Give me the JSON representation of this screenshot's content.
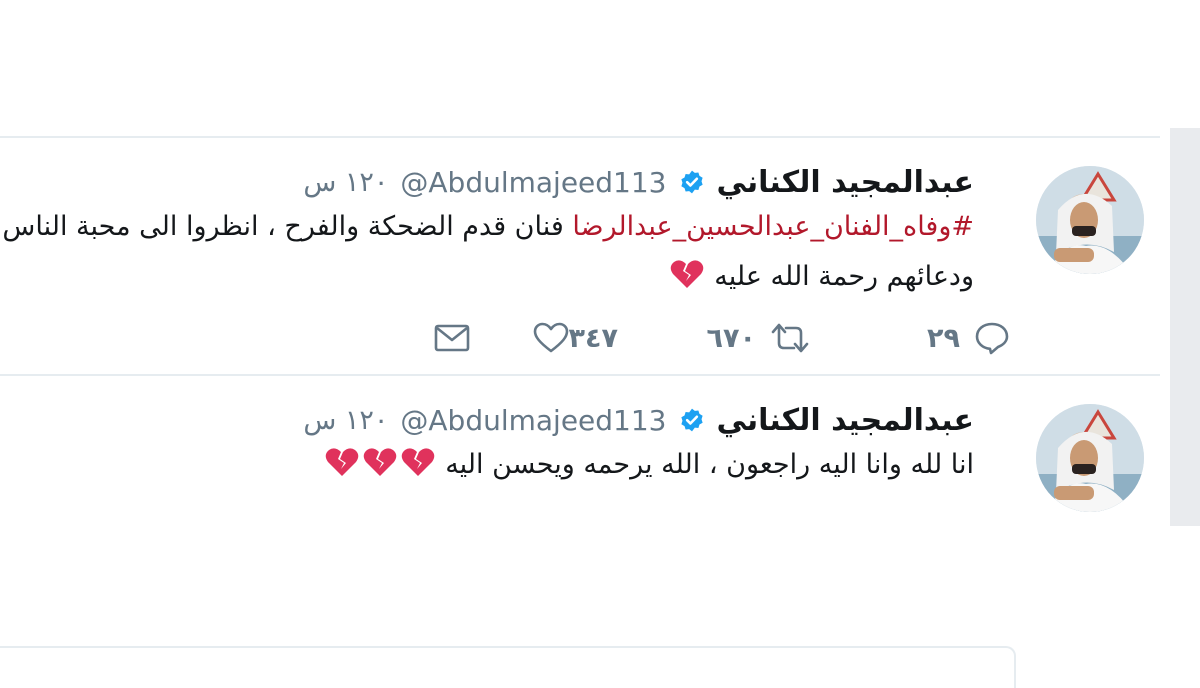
{
  "colors": {
    "hashtag": "#b2182b",
    "secondary_text": "#657786",
    "verified_badge": "#1da1f2",
    "broken_heart": "#e0325c"
  },
  "tweets": [
    {
      "display_name": "عبدالمجيد الكناني",
      "handle": "@Abdulmajeed113",
      "timestamp": "١٢٠ س",
      "hashtag": "#وفاه_الفنان_عبدالحسين_عبدالرضا",
      "text": " فنان قدم الضحكة والفرح ، انظروا الى محبة الناس ودعائهم رحمة الله عليه",
      "emoji": [
        "broken-heart"
      ],
      "replies": "٢٩",
      "retweets": "٦٧٠",
      "likes": "٣٤٧"
    },
    {
      "display_name": "عبدالمجيد الكناني",
      "handle": "@Abdulmajeed113",
      "timestamp": "١٢٠ س",
      "text": "انا لله وانا اليه راجعون ، الله يرحمه ويحسن اليه",
      "emoji": [
        "broken-heart",
        "broken-heart",
        "broken-heart"
      ]
    }
  ],
  "icons": {
    "reply": "reply-icon",
    "retweet": "retweet-icon",
    "like": "heart-icon",
    "dm": "envelope-icon",
    "verified": "verified-badge-icon"
  }
}
